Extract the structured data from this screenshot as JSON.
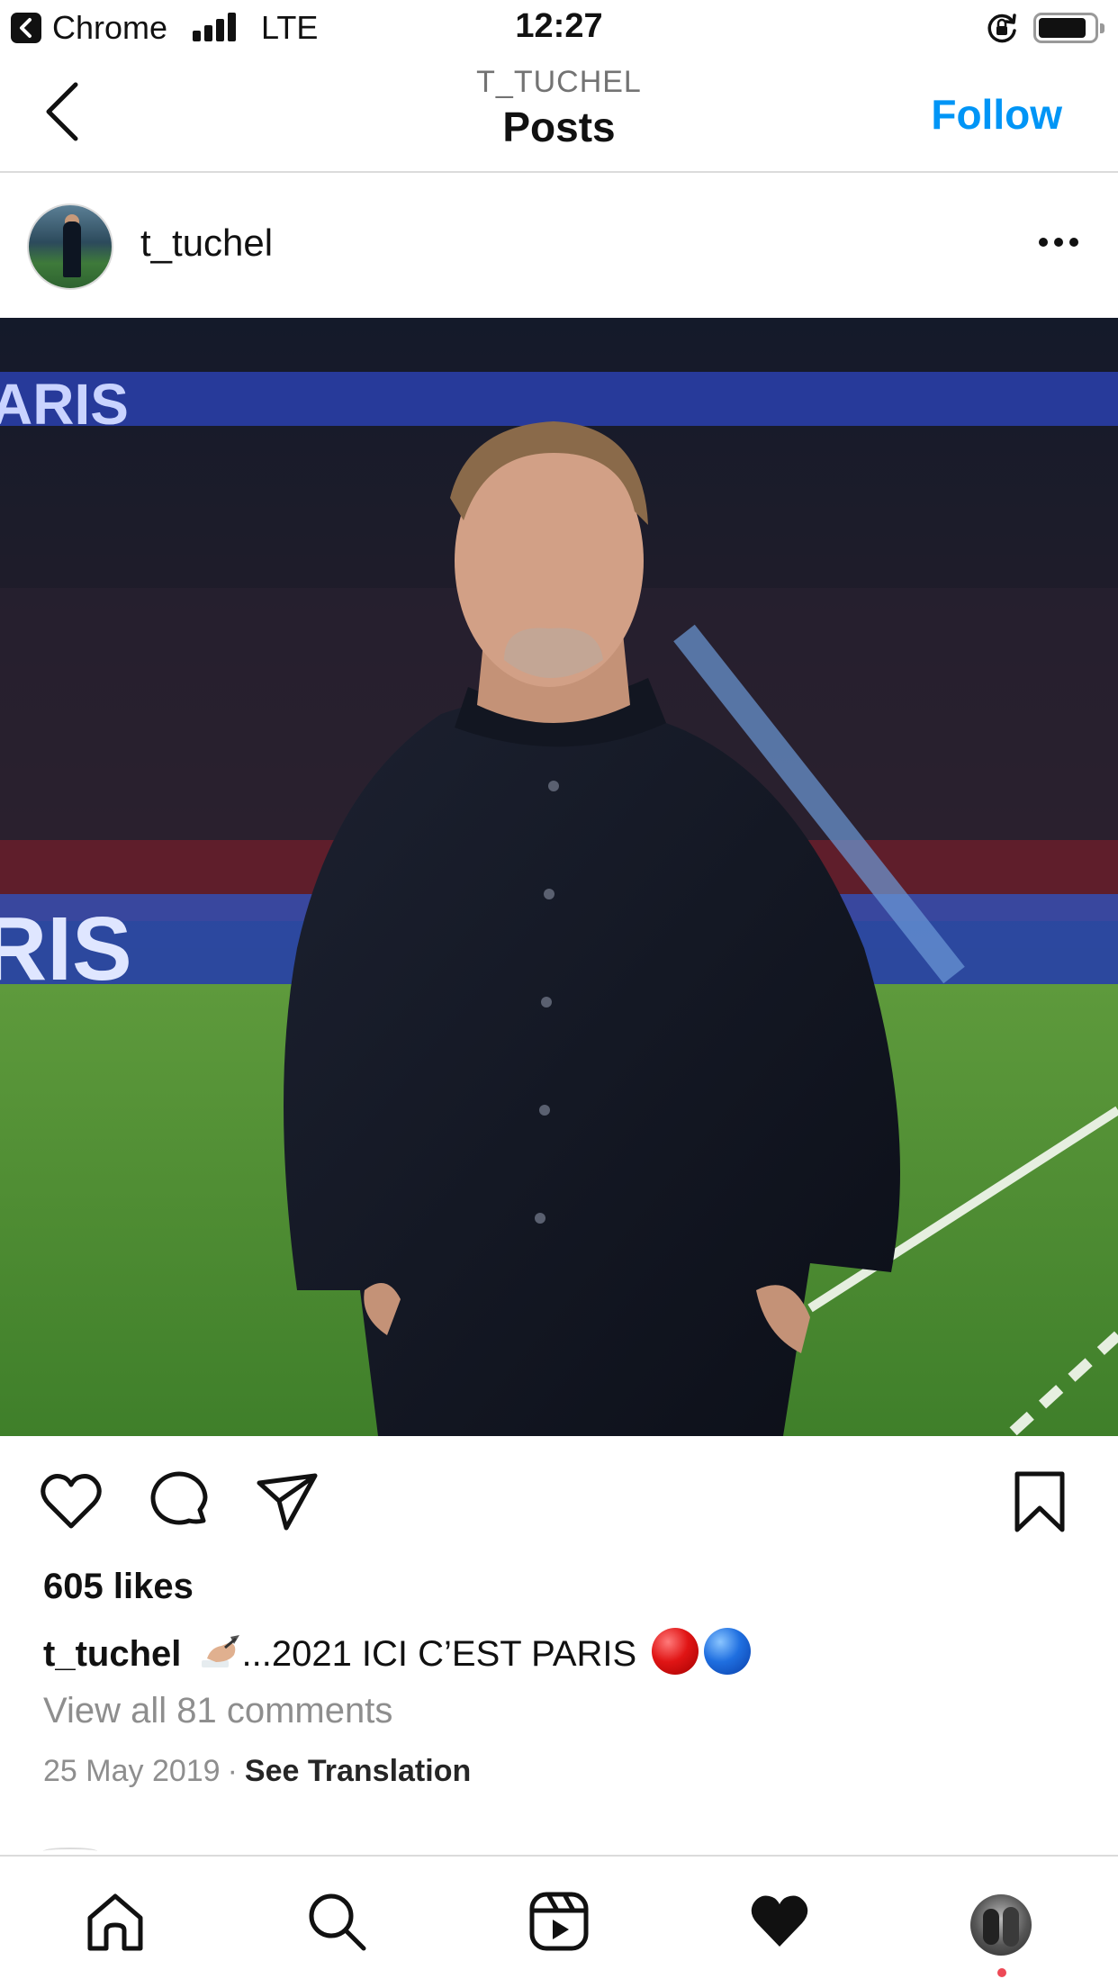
{
  "status_bar": {
    "app": "Chrome",
    "network": "LTE",
    "time": "12:27",
    "signal_icon": "signal-bars-icon",
    "battery_icon": "battery-icon",
    "lock_icon": "orientation-lock-icon"
  },
  "header": {
    "username": "T_TUCHEL",
    "title": "Posts",
    "follow_label": "Follow"
  },
  "post": {
    "username": "t_tuchel",
    "image_alt": "Photo of man in dark jacket at stadium",
    "likes": "605 likes",
    "caption_user": "t_tuchel",
    "caption_text": "...2021 ICI C’EST PARIS",
    "comments_link": "View all 81 comments",
    "date": "25 May 2019",
    "separator": "·",
    "translate_label": "See Translation"
  },
  "colors": {
    "accent": "#0095f6",
    "text": "#111111",
    "muted": "#8e8e8e",
    "divider": "#dbdbdb",
    "notification": "#ed4956"
  },
  "nav": {
    "items": [
      "home-icon",
      "search-icon",
      "reels-icon",
      "activity-heart-icon",
      "profile-avatar"
    ]
  }
}
